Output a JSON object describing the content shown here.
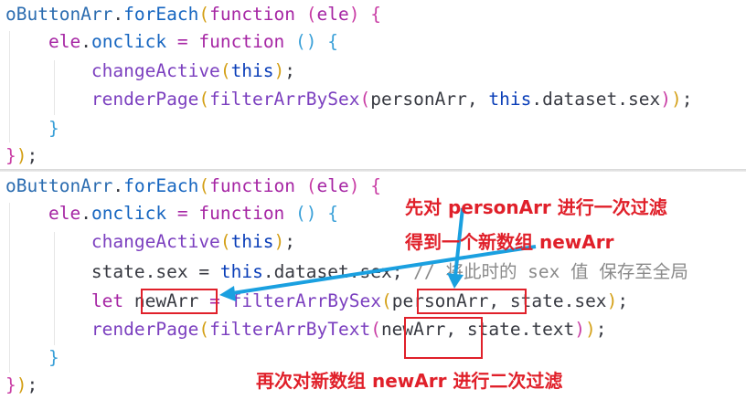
{
  "colors": {
    "annotation": "#e0202a",
    "arrow": "#1aa0e0",
    "keyword": "#a626a4",
    "variable": "#2b6cb0",
    "call": "#7b3fbf",
    "comment": "#8a8a8a"
  },
  "code_top": {
    "lines": [
      [
        [
          "oButtonArr",
          "var"
        ],
        [
          ".",
          "plain"
        ],
        [
          "forEach",
          "fn"
        ],
        [
          "(",
          "p1"
        ],
        [
          "function",
          "kw"
        ],
        [
          " ",
          "plain"
        ],
        [
          "(",
          "p2"
        ],
        [
          "ele",
          "kw"
        ],
        [
          ")",
          "p2"
        ],
        [
          " {",
          "p2"
        ]
      ],
      [
        [
          "    ",
          "plain"
        ],
        [
          "ele",
          "kw"
        ],
        [
          ".",
          "plain"
        ],
        [
          "onclick",
          "fn"
        ],
        [
          " = ",
          "kw"
        ],
        [
          "function",
          "kw"
        ],
        [
          " ",
          "plain"
        ],
        [
          "()",
          "p3"
        ],
        [
          " {",
          "p3"
        ]
      ],
      [
        [
          "        ",
          "plain"
        ],
        [
          "changeActive",
          "call"
        ],
        [
          "(",
          "p1"
        ],
        [
          "this",
          "this"
        ],
        [
          ")",
          "p1"
        ],
        [
          ";",
          "plain"
        ]
      ],
      [
        [
          "        ",
          "plain"
        ],
        [
          "renderPage",
          "call"
        ],
        [
          "(",
          "p1"
        ],
        [
          "filterArrBySex",
          "call"
        ],
        [
          "(",
          "p2"
        ],
        [
          "personArr",
          "plain"
        ],
        [
          ", ",
          "plain"
        ],
        [
          "this",
          "this"
        ],
        [
          ".",
          "plain"
        ],
        [
          "dataset",
          "plain"
        ],
        [
          ".",
          "plain"
        ],
        [
          "sex",
          "plain"
        ],
        [
          ")",
          "p2"
        ],
        [
          ")",
          "p1"
        ],
        [
          ";",
          "plain"
        ]
      ],
      [
        [
          "    ",
          "plain"
        ],
        [
          "}",
          "p3"
        ]
      ],
      [
        [
          "}",
          "p2"
        ],
        [
          ")",
          "p1"
        ],
        [
          ";",
          "plain"
        ]
      ]
    ]
  },
  "code_bottom": {
    "lines": [
      [
        [
          "oButtonArr",
          "var"
        ],
        [
          ".",
          "plain"
        ],
        [
          "forEach",
          "fn"
        ],
        [
          "(",
          "p1"
        ],
        [
          "function",
          "kw"
        ],
        [
          " ",
          "plain"
        ],
        [
          "(",
          "p2"
        ],
        [
          "ele",
          "kw"
        ],
        [
          ")",
          "p2"
        ],
        [
          " {",
          "p2"
        ]
      ],
      [
        [
          "    ",
          "plain"
        ],
        [
          "ele",
          "kw"
        ],
        [
          ".",
          "plain"
        ],
        [
          "onclick",
          "fn"
        ],
        [
          " = ",
          "kw"
        ],
        [
          "function",
          "kw"
        ],
        [
          " ",
          "plain"
        ],
        [
          "()",
          "p3"
        ],
        [
          " {",
          "p3"
        ]
      ],
      [
        [
          "        ",
          "plain"
        ],
        [
          "changeActive",
          "call"
        ],
        [
          "(",
          "p1"
        ],
        [
          "this",
          "this"
        ],
        [
          ")",
          "p1"
        ],
        [
          ";",
          "plain"
        ]
      ],
      [
        [
          "        ",
          "plain"
        ],
        [
          "state",
          "plain"
        ],
        [
          ".",
          "plain"
        ],
        [
          "sex",
          "plain"
        ],
        [
          " = ",
          "plain"
        ],
        [
          "this",
          "this"
        ],
        [
          ".",
          "plain"
        ],
        [
          "dataset",
          "plain"
        ],
        [
          ".",
          "plain"
        ],
        [
          "sex",
          "plain"
        ],
        [
          ";",
          "plain"
        ],
        [
          " // 将此时的 sex 值 保存至全局",
          "comment"
        ]
      ],
      [
        [
          "        ",
          "plain"
        ],
        [
          "let",
          "kw"
        ],
        [
          " ",
          "plain"
        ],
        [
          "newArr",
          "plain"
        ],
        [
          " = ",
          "kw"
        ],
        [
          "filterArrBySex",
          "call"
        ],
        [
          "(",
          "p1"
        ],
        [
          "personArr",
          "plain"
        ],
        [
          ", ",
          "plain"
        ],
        [
          "state",
          "plain"
        ],
        [
          ".",
          "plain"
        ],
        [
          "sex",
          "plain"
        ],
        [
          ")",
          "p1"
        ],
        [
          ";",
          "plain"
        ]
      ],
      [
        [
          "        ",
          "plain"
        ],
        [
          "renderPage",
          "call"
        ],
        [
          "(",
          "p1"
        ],
        [
          "filterArrByText",
          "call"
        ],
        [
          "(",
          "p2"
        ],
        [
          "newArr",
          "plain"
        ],
        [
          ", ",
          "plain"
        ],
        [
          "state",
          "plain"
        ],
        [
          ".",
          "plain"
        ],
        [
          "text",
          "plain"
        ],
        [
          ")",
          "p2"
        ],
        [
          ")",
          "p1"
        ],
        [
          ";",
          "plain"
        ]
      ],
      [
        [
          "    ",
          "plain"
        ],
        [
          "}",
          "p3"
        ]
      ],
      [
        [
          "}",
          "p2"
        ],
        [
          ")",
          "p1"
        ],
        [
          ";",
          "plain"
        ]
      ]
    ]
  },
  "annotations": {
    "first_filter_line1": "先对 personArr 进行一次过滤",
    "first_filter_line2": "得到一个新数组 newArr",
    "second_filter": "再次对新数组 newArr 进行二次过滤"
  }
}
